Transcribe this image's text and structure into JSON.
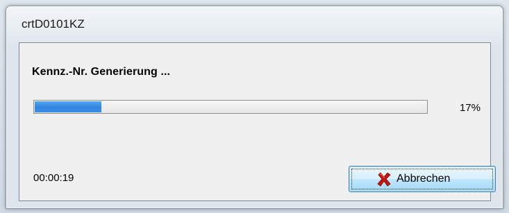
{
  "window": {
    "title": "crtD0101KZ"
  },
  "dialog": {
    "heading": "Kennz.-Nr. Generierung ...",
    "progress_percent": 17,
    "progress_label": "17%",
    "elapsed_time": "00:00:19"
  },
  "buttons": {
    "cancel_label": "Abbrechen",
    "cancel_icon": "red-x-icon"
  },
  "colors": {
    "progress_fill": "#3b8ee4",
    "cancel_icon": "#c8140c"
  }
}
